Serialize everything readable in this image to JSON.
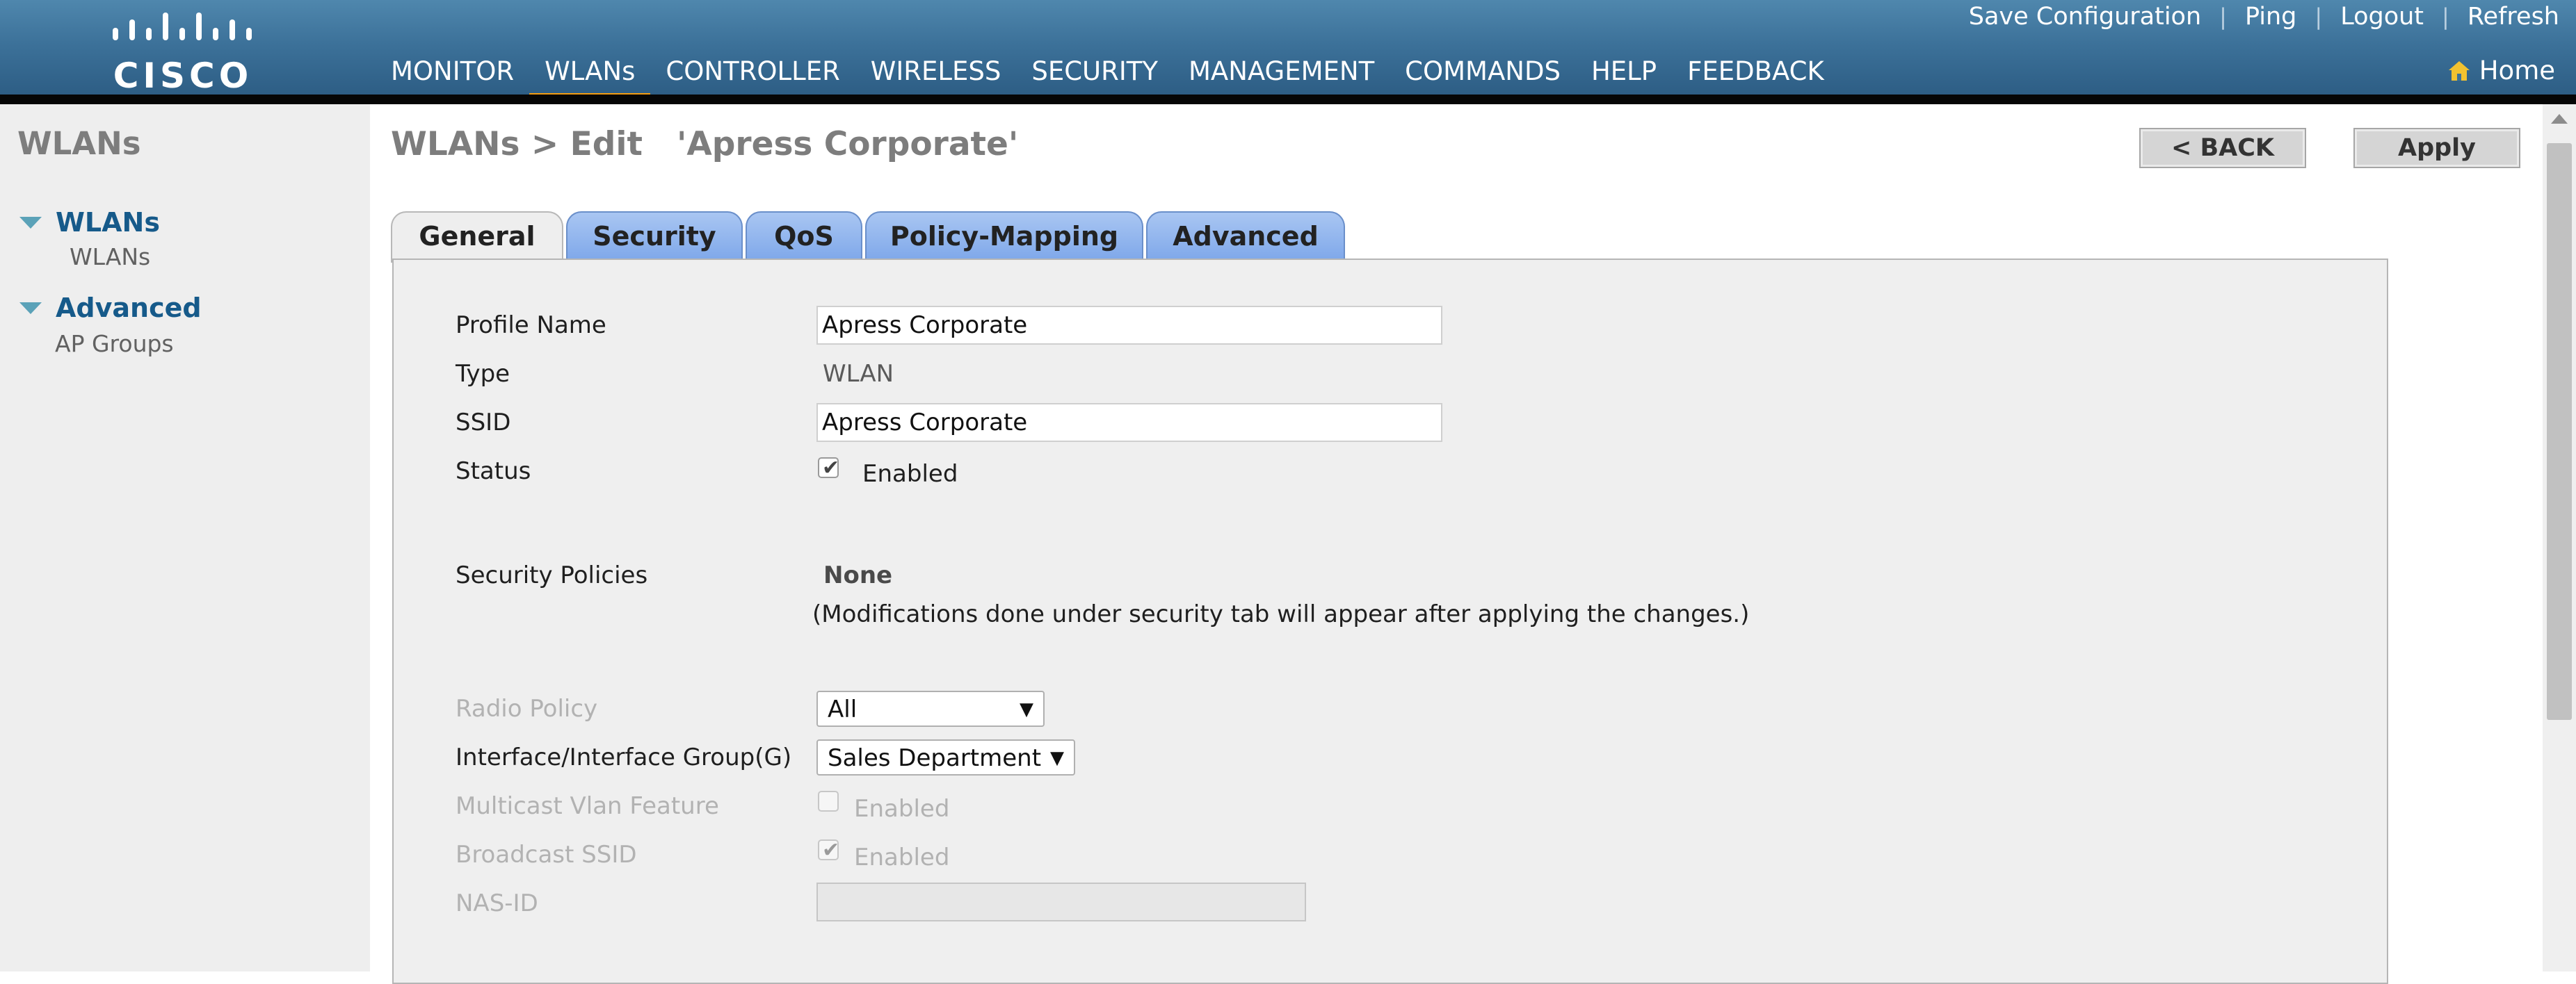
{
  "brand": {
    "logo_text": "CISCO"
  },
  "header": {
    "nav": [
      {
        "label": "MONITOR",
        "active": false
      },
      {
        "label": "WLANs",
        "active": true
      },
      {
        "label": "CONTROLLER",
        "active": false
      },
      {
        "label": "WIRELESS",
        "active": false
      },
      {
        "label": "SECURITY",
        "active": false
      },
      {
        "label": "MANAGEMENT",
        "active": false
      },
      {
        "label": "COMMANDS",
        "active": false
      },
      {
        "label": "HELP",
        "active": false
      },
      {
        "label": "FEEDBACK",
        "active": false
      }
    ],
    "top_links": [
      "Save Configuration",
      "Ping",
      "Logout",
      "Refresh"
    ],
    "home_label": "Home"
  },
  "sidebar": {
    "title": "WLANs",
    "groups": [
      {
        "label": "WLANs",
        "items": [
          "WLANs"
        ]
      },
      {
        "label": "Advanced",
        "items": [
          "AP Groups"
        ]
      }
    ]
  },
  "page": {
    "title": "WLANs > Edit   'Apress Corporate'",
    "back_label": "< BACK",
    "apply_label": "Apply"
  },
  "tabs": [
    "General",
    "Security",
    "QoS",
    "Policy-Mapping",
    "Advanced"
  ],
  "form": {
    "profile_name": {
      "label": "Profile Name",
      "value": "Apress Corporate"
    },
    "type": {
      "label": "Type",
      "value": "WLAN"
    },
    "ssid": {
      "label": "SSID",
      "value": "Apress Corporate"
    },
    "status": {
      "label": "Status",
      "checked": true,
      "text": "Enabled"
    },
    "security_policies": {
      "label": "Security Policies",
      "value": "None",
      "note": "(Modifications done under security tab will appear after applying the changes.)"
    },
    "radio_policy": {
      "label": "Radio Policy",
      "value": "All"
    },
    "interface_group": {
      "label": "Interface/Interface Group(G)",
      "value": "Sales Department"
    },
    "multicast_vlan": {
      "label": "Multicast Vlan Feature",
      "checked": false,
      "text": "Enabled"
    },
    "broadcast_ssid": {
      "label": "Broadcast SSID",
      "checked": true,
      "text": "Enabled"
    },
    "nas_id": {
      "label": "NAS-ID",
      "value": ""
    }
  },
  "colors": {
    "header_bg": "#3c7199",
    "active_nav_underline": "#f39c12",
    "tab_bg": "#8fb2ee",
    "sidebar_link": "#165a8a"
  }
}
